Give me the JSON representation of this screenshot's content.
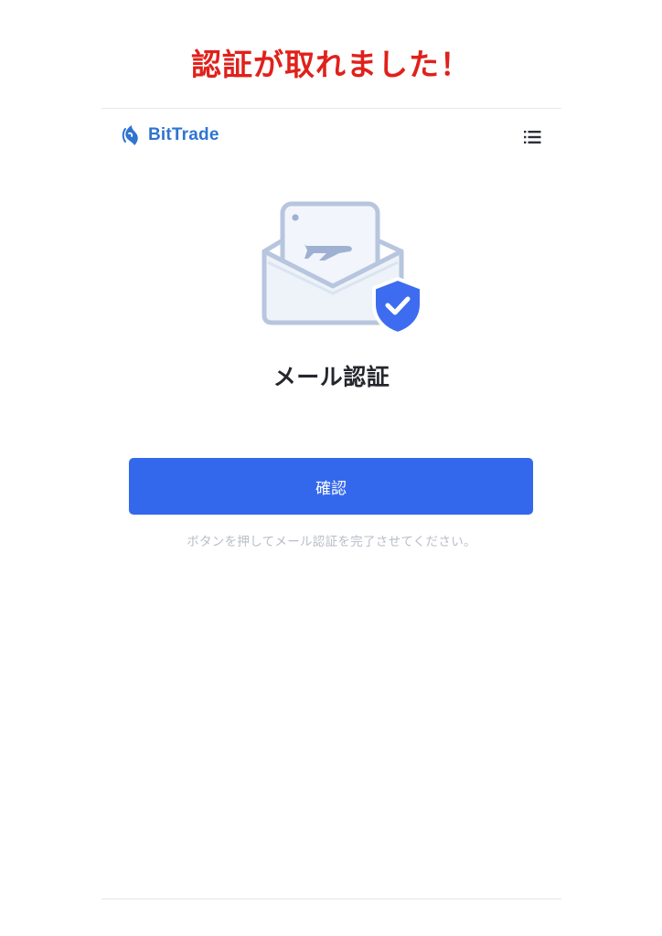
{
  "annotation": {
    "text": "認証が取れました！",
    "color": "#e0211b"
  },
  "header": {
    "logo_text": "BitTrade",
    "logo_color": "#2f74d0",
    "menu_icon": "menu-list-icon"
  },
  "main": {
    "illustration_icon": "email-verified-shield-icon",
    "title": "メール認証",
    "confirm_button_label": "確認",
    "helper_text": "ボタンを押してメール認証を完了させてください。"
  },
  "colors": {
    "primary_button": "#3468ec",
    "title_text": "#25272d",
    "helper_text": "#b8bdc7",
    "shield": "#3d6cf0",
    "envelope": "#b7c6de"
  }
}
